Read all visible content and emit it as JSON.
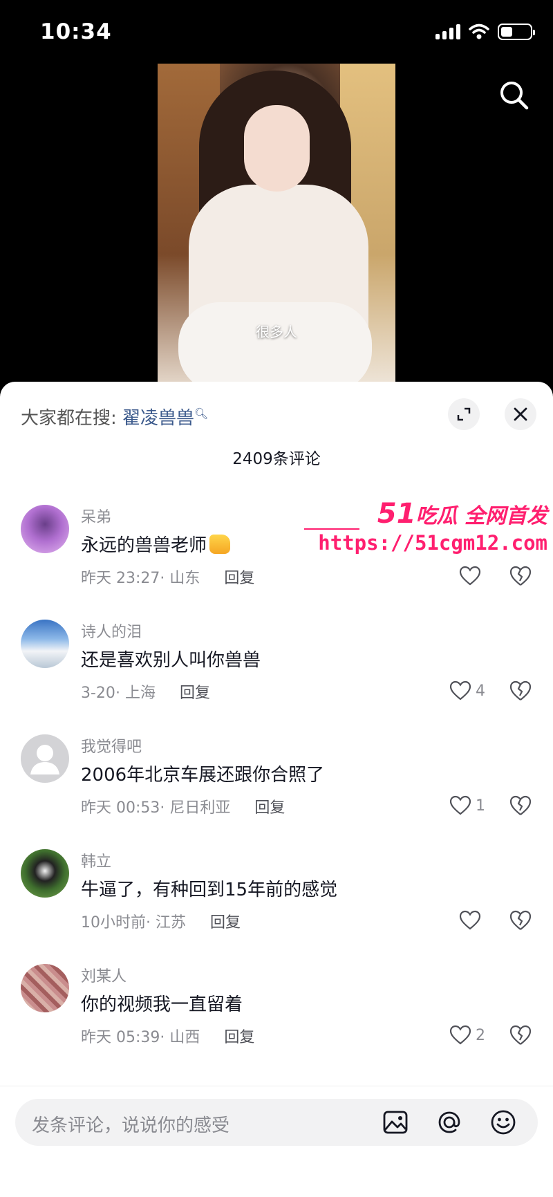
{
  "status_bar": {
    "time": "10:34"
  },
  "video": {
    "subtitle": "很多人"
  },
  "comments_panel": {
    "hot_search_prefix": "大家都在搜:",
    "hot_search_keyword": "翟凌兽兽",
    "count_label": "2409条评论",
    "comments": [
      {
        "user": "呆弟",
        "text": "永远的兽兽老师",
        "time": "昨天 23:27",
        "location": "山东",
        "likes": ""
      },
      {
        "user": "诗人的泪",
        "text": "还是喜欢别人叫你兽兽",
        "time": "3-20",
        "location": "上海",
        "likes": "4"
      },
      {
        "user": "我觉得吧",
        "text": "2006年北京车展还跟你合照了",
        "time": "昨天 00:53",
        "location": "尼日利亚",
        "likes": "1"
      },
      {
        "user": "韩立",
        "text": "牛逼了，有种回到15年前的感觉",
        "time": "10小时前",
        "location": "江苏",
        "likes": ""
      },
      {
        "user": "刘某人",
        "text": "你的视频我一直留着",
        "time": "昨天 05:39",
        "location": "山西",
        "likes": "2"
      }
    ],
    "reply_label": "回复",
    "meta_separator": "·"
  },
  "watermark": {
    "brand_num": "51",
    "brand_text": "吃瓜 全网首发",
    "url": "https://51cgm12.com"
  },
  "input": {
    "placeholder": "发条评论，说说你的感受"
  },
  "icons": {
    "search": "search-icon",
    "expand": "expand-icon",
    "close": "close-icon",
    "like": "heart-icon",
    "dislike": "broken-heart-icon",
    "image": "image-icon",
    "mention": "at-icon",
    "emoji": "emoji-icon"
  },
  "colors": {
    "keyword": "#3c5a8c",
    "watermark": "#ff1f6f",
    "secondary_text": "#8a8b91"
  }
}
